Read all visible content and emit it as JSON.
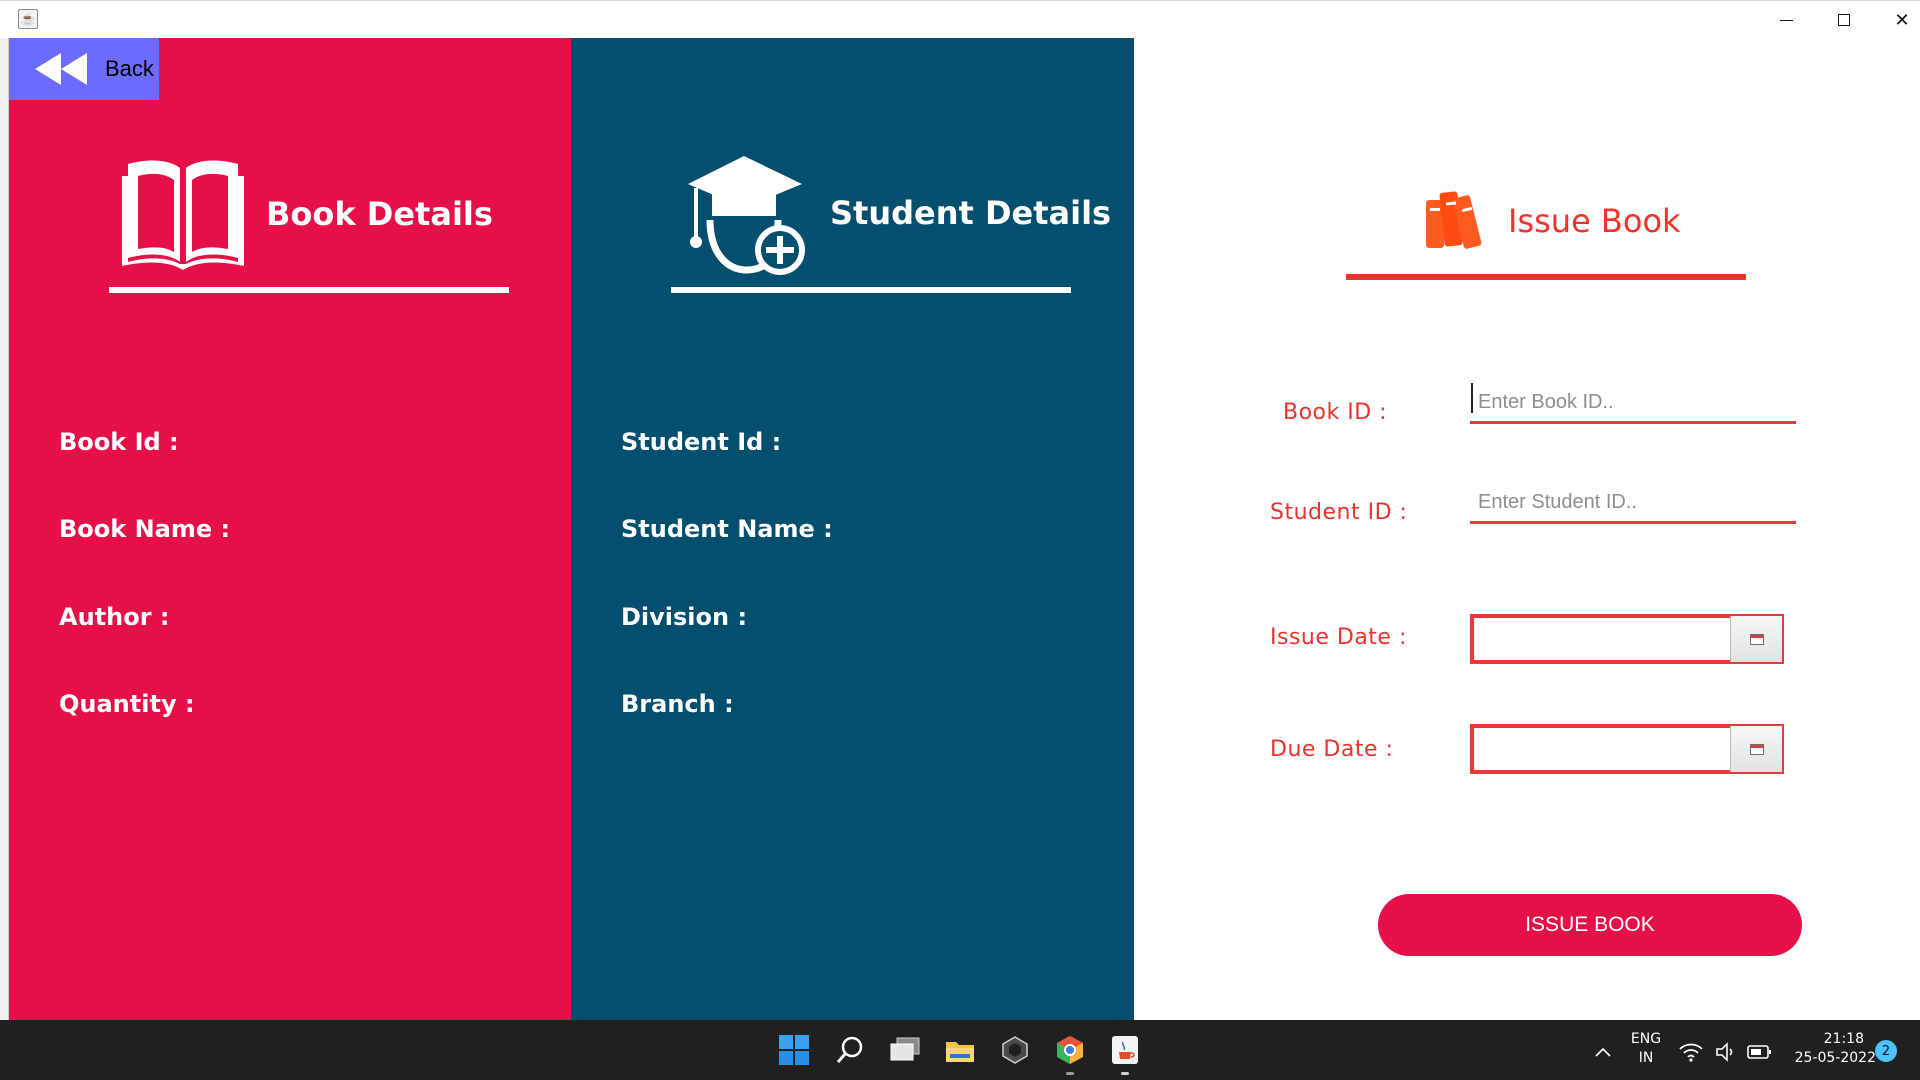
{
  "window": {
    "app_icon": "java-icon",
    "controls": {
      "minimize": "minimize-icon",
      "maximize": "maximize-icon",
      "close": "close-icon"
    }
  },
  "back_button": {
    "label": "Back",
    "icon": "rewind-icon"
  },
  "book_panel": {
    "title": "Book Details",
    "icon": "open-book-icon",
    "color": "#e60f48",
    "fields": [
      "Book Id :",
      "Book Name :",
      "Author :",
      "Quantity :"
    ]
  },
  "student_panel": {
    "title": "Student Details",
    "icon": "student-add-icon",
    "color": "#044e6e",
    "fields": [
      "Student Id :",
      "Student Name :",
      "Division :",
      "Branch :"
    ]
  },
  "issue_panel": {
    "title": "Issue Book",
    "icon": "books-icon",
    "accent_color": "#f2322c",
    "form": {
      "book_id_label": "Book ID :",
      "book_id_placeholder": "Enter Book ID..",
      "student_id_label": "Student ID :",
      "student_id_placeholder": "Enter Student ID..",
      "issue_date_label": "Issue Date :",
      "due_date_label": "Due Date :",
      "date_button_icon": "calendar-icon"
    },
    "submit_label": "ISSUE BOOK"
  },
  "taskbar": {
    "apps": [
      "windows-start-icon",
      "search-icon",
      "task-view-icon",
      "file-explorer-icon",
      "app-icon",
      "chrome-icon",
      "java-icon"
    ],
    "tray": {
      "language_line1": "ENG",
      "language_line2": "IN",
      "time": "21:18",
      "date": "25-05-2022",
      "notifications": "2"
    }
  }
}
